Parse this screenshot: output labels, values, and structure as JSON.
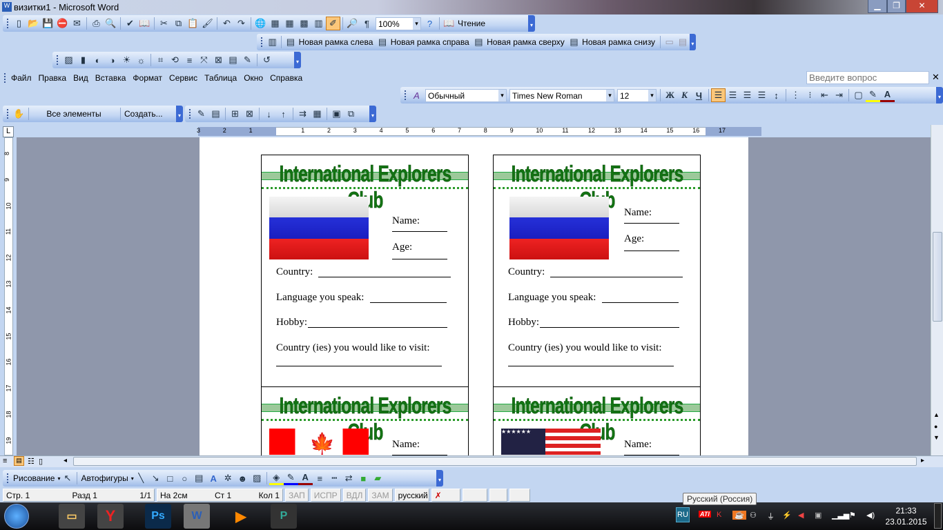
{
  "window": {
    "title": "визитки1 - Microsoft Word",
    "controls": [
      "minimize",
      "maximize",
      "close"
    ]
  },
  "standard_toolbar": {
    "icons": [
      "new",
      "open",
      "save",
      "permission",
      "email",
      "|",
      "print",
      "print-preview",
      "|",
      "spelling",
      "research",
      "|",
      "cut",
      "copy",
      "paste",
      "format-painter",
      "|",
      "undo",
      "redo",
      "|",
      "hyperlink",
      "tables-borders",
      "insert-table",
      "insert-excel",
      "columns",
      "drawing",
      "|",
      "document-map",
      "show-formatting"
    ],
    "zoom": "100%",
    "read_label": "Чтение"
  },
  "frames_toolbar": {
    "items": [
      "Новая рамка слева",
      "Новая рамка справа",
      "Новая рамка сверху",
      "Новая рамка снизу"
    ]
  },
  "picture_toolbar": {
    "icons": [
      "insert-picture",
      "color",
      "more-contrast",
      "less-contrast",
      "more-brightness",
      "less-brightness",
      "|",
      "crop",
      "rotate-left",
      "line-style",
      "compress",
      "text-wrapping",
      "format-picture",
      "set-transparent",
      "|",
      "reset-picture"
    ]
  },
  "menu": [
    "Файл",
    "Правка",
    "Вид",
    "Вставка",
    "Формат",
    "Сервис",
    "Таблица",
    "Окно",
    "Справка"
  ],
  "ask_placeholder": "Введите вопрос",
  "formatting_toolbar": {
    "style": "Обычный",
    "font": "Times New Roman",
    "size": "12",
    "bold": "Ж",
    "italic": "К",
    "underline": "Ч",
    "align": "left"
  },
  "forms_toolbar": {
    "all_elements": "Все элементы",
    "create": "Создать..."
  },
  "ruler_h": [
    "3",
    "2",
    "1",
    "",
    "1",
    "2",
    "3",
    "4",
    "5",
    "6",
    "7",
    "8",
    "9",
    "10",
    "11",
    "12",
    "13",
    "14",
    "15",
    "16",
    "17"
  ],
  "ruler_v": [
    "8",
    "9",
    "10",
    "11",
    "12",
    "13",
    "14",
    "15",
    "16",
    "17",
    "18",
    "19"
  ],
  "cards": [
    {
      "title": "International Explorers Club",
      "flag": "russia",
      "name": "Name:",
      "age": "Age:",
      "country": "Country:",
      "language": "Language you speak:",
      "hobby": "Hobby:",
      "visit": "Country (ies) you would like to visit:"
    },
    {
      "title": "International Explorers Club",
      "flag": "russia",
      "name": "Name:",
      "age": "Age:",
      "country": "Country:",
      "language": "Language you speak:",
      "hobby": "Hobby:",
      "visit": "Country (ies) you would like to visit:"
    },
    {
      "title": "International Explorers Club",
      "flag": "canada",
      "name": "Name:"
    },
    {
      "title": "International Explorers Club",
      "flag": "usa",
      "name": "Name:"
    }
  ],
  "drawing_toolbar": {
    "draw": "Рисование",
    "autoshapes": "Автофигуры"
  },
  "status": {
    "page": "Стр. 1",
    "section": "Разд 1",
    "pages": "1/1",
    "at": "На 2см",
    "line": "Ст 1",
    "col": "Кол 1",
    "rec": "ЗАП",
    "trk": "ИСПР",
    "ext": "ВДЛ",
    "ovr": "ЗАМ",
    "lang": "русский (Ро"
  },
  "taskbar": {
    "apps": [
      "explorer",
      "yandex",
      "photoshop",
      "word",
      "media-player",
      "publisher"
    ],
    "lang": "RU",
    "tooltip": "Русский (Россия)",
    "time": "21:33",
    "date": "23.01.2015"
  }
}
